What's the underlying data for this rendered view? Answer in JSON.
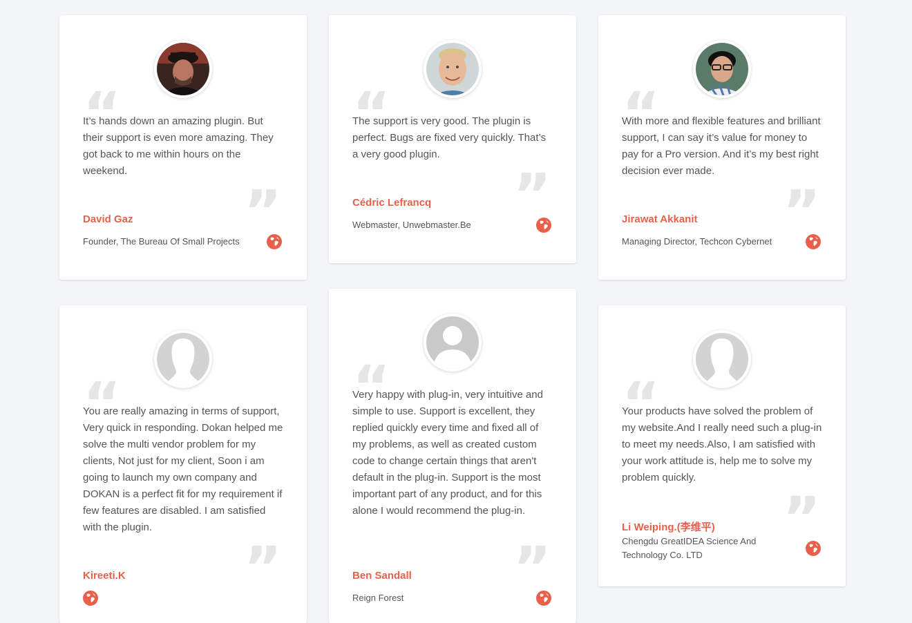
{
  "colors": {
    "accent": "#e8604c",
    "background": "#f3f5f8",
    "quote": "#e6e6e6"
  },
  "testimonials": [
    {
      "text": "It’s hands down an amazing plugin. But their support is even more amazing. They got back to me within hours on the weekend.",
      "name": "David Gaz",
      "role": "Founder, The Bureau Of Small Projects",
      "avatar": "photo-man-cap",
      "icon": "globe-icon"
    },
    {
      "text": "The support is very good. The plugin is perfect. Bugs are fixed very quickly. That’s a very good plugin.",
      "name": "Cédric Lefrancq",
      "role": "Webmaster, Unwebmaster.Be",
      "avatar": "photo-man-blond",
      "icon": "globe-icon"
    },
    {
      "text": "With more and flexible features and brilliant support, I can say it’s value for money to pay for a Pro version. And it’s my best right decision ever made.",
      "name": "Jirawat Akkanit",
      "role": "Managing Director, Techcon Cybernet",
      "avatar": "photo-man-glasses",
      "icon": "globe-icon"
    },
    {
      "text": "You are really amazing in terms of support, Very quick in responding. Dokan helped me solve the multi vendor problem for my clients, Not just for my client, Soon i am going to launch my own company and DOKAN is a perfect fit for my requirement if few features are disabled. I am satisfied with the plugin.",
      "name": "Kireeti.K",
      "role": "",
      "avatar": "placeholder-silhouette",
      "icon": "globe-icon"
    },
    {
      "text": "Very happy with plug-in, very intuitive and simple to use. Support is excellent, they replied quickly every time and fixed all of my problems, as well as created custom code to change certain things that aren't default in the plug-in. Support is the most important part of any product, and for this alone I would recommend the plug-in.",
      "name": "Ben Sandall",
      "role": "Reign Forest",
      "avatar": "placeholder-person",
      "icon": "globe-icon"
    },
    {
      "text": "Your products have solved the problem of my website.And I really need such a plug-in to meet my needs.Also, I am satisfied with your work attitude is, help me to solve my problem quickly.",
      "name": "Li Weiping.(李维平)",
      "role": "Chengdu GreatIDEA Science And Technology Co. LTD",
      "avatar": "placeholder-silhouette",
      "icon": "globe-icon"
    }
  ]
}
